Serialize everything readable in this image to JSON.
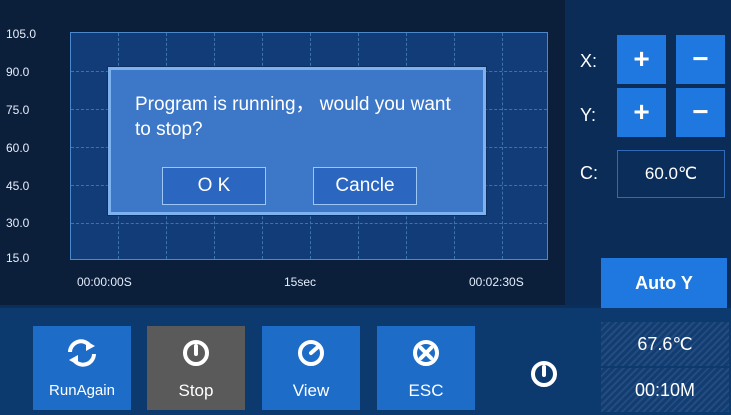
{
  "chart": {
    "y_ticks": [
      "105.0",
      "90.0",
      "75.0",
      "60.0",
      "45.0",
      "30.0",
      "15.0"
    ],
    "x_ticks": [
      "00:00:00S",
      "15sec",
      "00:02:30S"
    ]
  },
  "dialog": {
    "message": "Program is running， would you want to stop?",
    "ok_label": "O K",
    "cancel_label": "Cancle"
  },
  "controls": {
    "x_label": "X:",
    "y_label": "Y:",
    "c_label": "C:",
    "plus": "+",
    "minus": "−",
    "c_value": "60.0℃",
    "auto_y_label": "Auto Y"
  },
  "toolbar": {
    "run_again_label": "RunAgain",
    "stop_label": "Stop",
    "view_label": "View",
    "esc_label": "ESC"
  },
  "status": {
    "temperature": "67.6℃",
    "elapsed": "00:10M"
  },
  "icons": {
    "run_again": "refresh-arrows-icon",
    "stop": "power-icon",
    "view": "gauge-icon",
    "esc": "close-circle-icon",
    "power": "power-icon"
  },
  "colors": {
    "accent": "#1e78e0",
    "stop_button": "#5a5a5a",
    "dialog_bg": "#3d77c7",
    "plot_bg": "#123c78"
  }
}
